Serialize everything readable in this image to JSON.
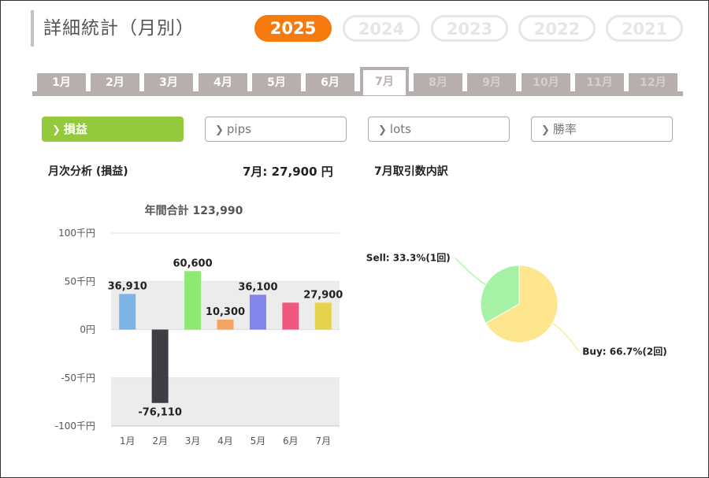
{
  "page": {
    "title": "詳細統計（月別）"
  },
  "years": [
    {
      "label": "2025",
      "active": true
    },
    {
      "label": "2024",
      "active": false
    },
    {
      "label": "2023",
      "active": false
    },
    {
      "label": "2022",
      "active": false
    },
    {
      "label": "2021",
      "active": false
    }
  ],
  "months": [
    {
      "label": "1月",
      "state": "past"
    },
    {
      "label": "2月",
      "state": "past"
    },
    {
      "label": "3月",
      "state": "past"
    },
    {
      "label": "4月",
      "state": "past"
    },
    {
      "label": "5月",
      "state": "past"
    },
    {
      "label": "6月",
      "state": "past"
    },
    {
      "label": "7月",
      "state": "active"
    },
    {
      "label": "8月",
      "state": "future"
    },
    {
      "label": "9月",
      "state": "future"
    },
    {
      "label": "10月",
      "state": "future"
    },
    {
      "label": "11月",
      "state": "future"
    },
    {
      "label": "12月",
      "state": "future"
    }
  ],
  "metrics": [
    {
      "label": "損益",
      "active": true
    },
    {
      "label": "pips",
      "active": false
    },
    {
      "label": "lots",
      "active": false
    },
    {
      "label": "勝率",
      "active": false
    }
  ],
  "analysis": {
    "left_title": "月次分析 (損益)",
    "month_value": "7月:  27,900 円",
    "right_title": "7月取引数内訳"
  },
  "chart_data": [
    {
      "type": "bar",
      "title": "年間合計 123,990",
      "categories": [
        "1月",
        "2月",
        "3月",
        "4月",
        "5月",
        "6月",
        "7月"
      ],
      "values": [
        36910,
        -76110,
        60600,
        10300,
        36100,
        27900,
        27900
      ],
      "value_labels": [
        "36,910",
        "-76,110",
        "60,600",
        "10,300",
        "36,100",
        "",
        "27,900"
      ],
      "colors": [
        "#7eb4e6",
        "#3e3e44",
        "#8ee874",
        "#f4a460",
        "#8384ec",
        "#f1587f",
        "#e5d34e"
      ],
      "ylim": [
        -100000,
        100000
      ],
      "yticks": [
        100000,
        50000,
        0,
        -50000,
        -100000
      ],
      "ytick_labels": [
        "100千円",
        "50千円",
        "0円",
        "-50千円",
        "-100千円"
      ]
    },
    {
      "type": "pie",
      "slices": [
        {
          "name": "Sell",
          "value": 33.3,
          "count": 1,
          "label": "Sell: 33.3%(1回)",
          "color": "#a6f2a4"
        },
        {
          "name": "Buy",
          "value": 66.7,
          "count": 2,
          "label": "Buy: 66.7%(2回)",
          "color": "#fde68d"
        }
      ]
    }
  ]
}
